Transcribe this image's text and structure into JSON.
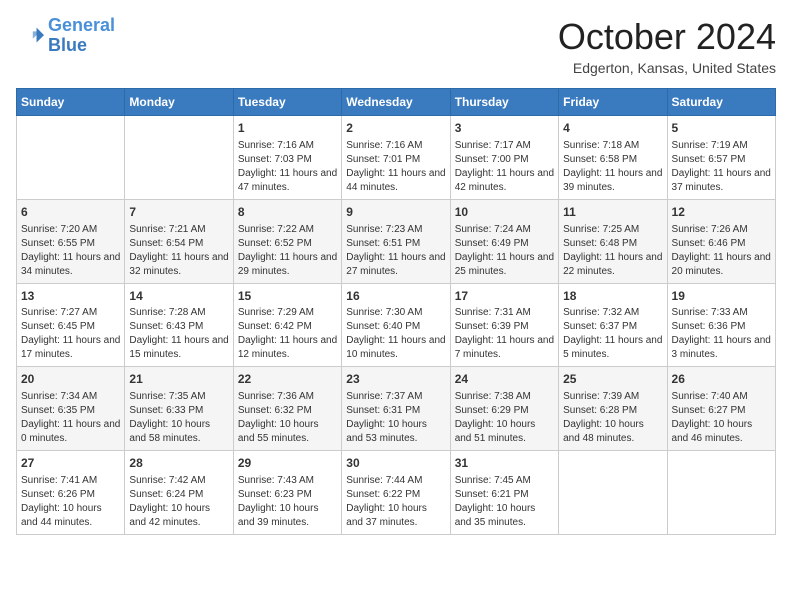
{
  "header": {
    "logo_line1": "General",
    "logo_line2": "Blue",
    "month": "October 2024",
    "location": "Edgerton, Kansas, United States"
  },
  "weekdays": [
    "Sunday",
    "Monday",
    "Tuesday",
    "Wednesday",
    "Thursday",
    "Friday",
    "Saturday"
  ],
  "weeks": [
    [
      {
        "day": "",
        "info": ""
      },
      {
        "day": "",
        "info": ""
      },
      {
        "day": "1",
        "info": "Sunrise: 7:16 AM\nSunset: 7:03 PM\nDaylight: 11 hours and 47 minutes."
      },
      {
        "day": "2",
        "info": "Sunrise: 7:16 AM\nSunset: 7:01 PM\nDaylight: 11 hours and 44 minutes."
      },
      {
        "day": "3",
        "info": "Sunrise: 7:17 AM\nSunset: 7:00 PM\nDaylight: 11 hours and 42 minutes."
      },
      {
        "day": "4",
        "info": "Sunrise: 7:18 AM\nSunset: 6:58 PM\nDaylight: 11 hours and 39 minutes."
      },
      {
        "day": "5",
        "info": "Sunrise: 7:19 AM\nSunset: 6:57 PM\nDaylight: 11 hours and 37 minutes."
      }
    ],
    [
      {
        "day": "6",
        "info": "Sunrise: 7:20 AM\nSunset: 6:55 PM\nDaylight: 11 hours and 34 minutes."
      },
      {
        "day": "7",
        "info": "Sunrise: 7:21 AM\nSunset: 6:54 PM\nDaylight: 11 hours and 32 minutes."
      },
      {
        "day": "8",
        "info": "Sunrise: 7:22 AM\nSunset: 6:52 PM\nDaylight: 11 hours and 29 minutes."
      },
      {
        "day": "9",
        "info": "Sunrise: 7:23 AM\nSunset: 6:51 PM\nDaylight: 11 hours and 27 minutes."
      },
      {
        "day": "10",
        "info": "Sunrise: 7:24 AM\nSunset: 6:49 PM\nDaylight: 11 hours and 25 minutes."
      },
      {
        "day": "11",
        "info": "Sunrise: 7:25 AM\nSunset: 6:48 PM\nDaylight: 11 hours and 22 minutes."
      },
      {
        "day": "12",
        "info": "Sunrise: 7:26 AM\nSunset: 6:46 PM\nDaylight: 11 hours and 20 minutes."
      }
    ],
    [
      {
        "day": "13",
        "info": "Sunrise: 7:27 AM\nSunset: 6:45 PM\nDaylight: 11 hours and 17 minutes."
      },
      {
        "day": "14",
        "info": "Sunrise: 7:28 AM\nSunset: 6:43 PM\nDaylight: 11 hours and 15 minutes."
      },
      {
        "day": "15",
        "info": "Sunrise: 7:29 AM\nSunset: 6:42 PM\nDaylight: 11 hours and 12 minutes."
      },
      {
        "day": "16",
        "info": "Sunrise: 7:30 AM\nSunset: 6:40 PM\nDaylight: 11 hours and 10 minutes."
      },
      {
        "day": "17",
        "info": "Sunrise: 7:31 AM\nSunset: 6:39 PM\nDaylight: 11 hours and 7 minutes."
      },
      {
        "day": "18",
        "info": "Sunrise: 7:32 AM\nSunset: 6:37 PM\nDaylight: 11 hours and 5 minutes."
      },
      {
        "day": "19",
        "info": "Sunrise: 7:33 AM\nSunset: 6:36 PM\nDaylight: 11 hours and 3 minutes."
      }
    ],
    [
      {
        "day": "20",
        "info": "Sunrise: 7:34 AM\nSunset: 6:35 PM\nDaylight: 11 hours and 0 minutes."
      },
      {
        "day": "21",
        "info": "Sunrise: 7:35 AM\nSunset: 6:33 PM\nDaylight: 10 hours and 58 minutes."
      },
      {
        "day": "22",
        "info": "Sunrise: 7:36 AM\nSunset: 6:32 PM\nDaylight: 10 hours and 55 minutes."
      },
      {
        "day": "23",
        "info": "Sunrise: 7:37 AM\nSunset: 6:31 PM\nDaylight: 10 hours and 53 minutes."
      },
      {
        "day": "24",
        "info": "Sunrise: 7:38 AM\nSunset: 6:29 PM\nDaylight: 10 hours and 51 minutes."
      },
      {
        "day": "25",
        "info": "Sunrise: 7:39 AM\nSunset: 6:28 PM\nDaylight: 10 hours and 48 minutes."
      },
      {
        "day": "26",
        "info": "Sunrise: 7:40 AM\nSunset: 6:27 PM\nDaylight: 10 hours and 46 minutes."
      }
    ],
    [
      {
        "day": "27",
        "info": "Sunrise: 7:41 AM\nSunset: 6:26 PM\nDaylight: 10 hours and 44 minutes."
      },
      {
        "day": "28",
        "info": "Sunrise: 7:42 AM\nSunset: 6:24 PM\nDaylight: 10 hours and 42 minutes."
      },
      {
        "day": "29",
        "info": "Sunrise: 7:43 AM\nSunset: 6:23 PM\nDaylight: 10 hours and 39 minutes."
      },
      {
        "day": "30",
        "info": "Sunrise: 7:44 AM\nSunset: 6:22 PM\nDaylight: 10 hours and 37 minutes."
      },
      {
        "day": "31",
        "info": "Sunrise: 7:45 AM\nSunset: 6:21 PM\nDaylight: 10 hours and 35 minutes."
      },
      {
        "day": "",
        "info": ""
      },
      {
        "day": "",
        "info": ""
      }
    ]
  ]
}
